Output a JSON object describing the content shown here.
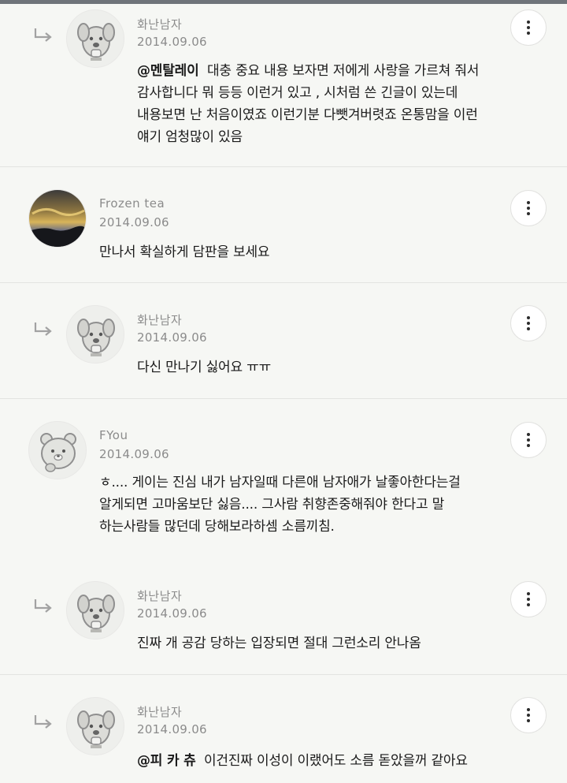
{
  "comments": [
    {
      "author": "화난남자",
      "date": "2014.09.06",
      "is_reply": true,
      "avatar": "dog-character",
      "mention": "@멘탈레이",
      "lines": [
        "대충 중요 내용 보자면 저에게 사랑을 가르쳐 줘서",
        "감사합니다 뭐 등등 이런거 있고 , 시처럼 쓴 긴글이 있는데",
        "내용보면 난 처음이였죠 이런기분 다뺏겨버렷죠 온통맘을 이런",
        "얘기 엄청많이 있음"
      ]
    },
    {
      "author": "Frozen tea",
      "date": "2014.09.06",
      "is_reply": false,
      "avatar": "sunset-sky-photo",
      "lines": [
        "만나서 확실하게 담판을 보세요"
      ]
    },
    {
      "author": "화난남자",
      "date": "2014.09.06",
      "is_reply": true,
      "avatar": "dog-character",
      "lines": [
        "다신 만나기 싫어요 ㅠㅠ"
      ]
    },
    {
      "author": "FYou",
      "date": "2014.09.06",
      "is_reply": false,
      "avatar": "bear-character",
      "lines": [
        "ㅎ.... 게이는 진심 내가 남자일때 다른애 남자애가 날좋아한다는걸",
        "알게되면 고마움보단 싫음.... 그사람 취향존중해줘야 한다고 말",
        "하는사람들 많던데 당해보라하셈 소름끼침."
      ]
    },
    {
      "author": "화난남자",
      "date": "2014.09.06",
      "is_reply": true,
      "avatar": "dog-character",
      "lines": [
        "진짜 개 공감 당하는 입장되면 절대 그런소리 안나옴"
      ]
    },
    {
      "author": "화난남자",
      "date": "2014.09.06",
      "is_reply": true,
      "avatar": "dog-character",
      "mention": "@피 카 츄",
      "lines": [
        "이건진짜 이성이 이랬어도 소름 돋았을꺼 같아요"
      ]
    }
  ],
  "icons": {
    "reply": "reply-arrow-icon",
    "more": "more-vertical-icon"
  },
  "colors": {
    "background": "#f6f7f4",
    "meta_text": "#8b8b8b",
    "body_text": "#1a1a1a"
  }
}
